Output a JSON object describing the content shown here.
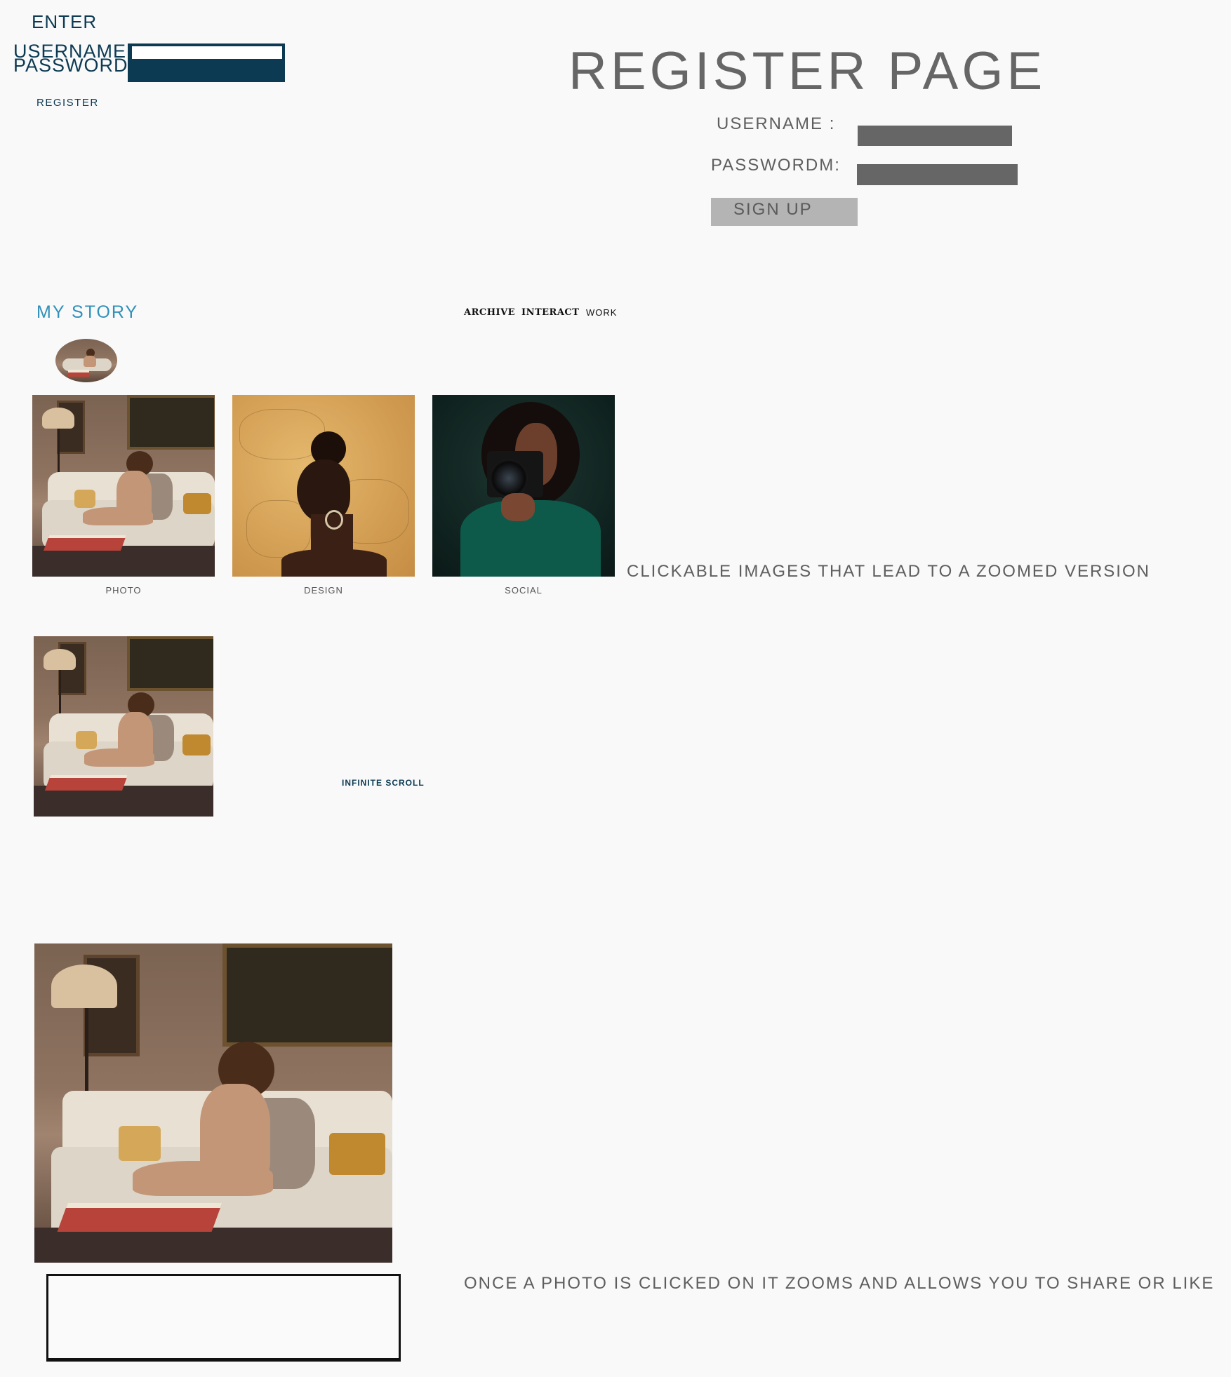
{
  "login": {
    "enter_label": "ENTER",
    "username_label": "USERNAME",
    "password_label": "PASSWORD",
    "register_link": "REGISTER"
  },
  "register": {
    "title": "REGISTER PAGE",
    "username_label": "USERNAME :",
    "password_label": "PASSWORDM:",
    "signup_label": "SIGN UP"
  },
  "story": {
    "heading": "MY STORY"
  },
  "nav": {
    "items": [
      "ARCHIVE",
      "INTERACT",
      "WORK"
    ]
  },
  "gallery": {
    "tiles": [
      {
        "caption": "PHOTO"
      },
      {
        "caption": "DESIGN"
      },
      {
        "caption": "SOCIAL"
      }
    ],
    "note": "CLICKABLE IMAGES THAT LEAD TO A ZOOMED VERSION"
  },
  "scroll": {
    "label": "INFINITE SCROLL"
  },
  "zoom": {
    "note": "ONCE A PHOTO IS CLICKED ON IT ZOOMS AND ALLOWS YOU TO SHARE OR LIKE"
  },
  "colors": {
    "brand_navy": "#0c3a52",
    "story_blue": "#3090b8",
    "input_gray": "#666666",
    "button_gray": "#b4b4b4",
    "background": "#f9f9f9"
  }
}
